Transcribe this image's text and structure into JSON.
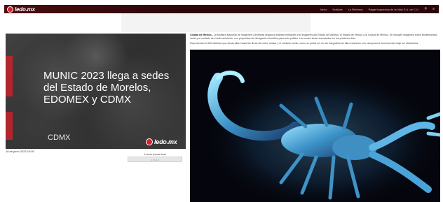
{
  "header": {
    "logo_text": "ledo.mx",
    "nav": [
      "Inicio",
      "Noticias",
      "La Reforma",
      "Pagar Impuestos de la Vida S.A. de C.V."
    ],
    "search_icon": "search-icon",
    "menu_icon": "menu-icon"
  },
  "video": {
    "title": "MUNIC 2023 llega a sedes del Estado de Morelos, EDOMEX y CDMX",
    "city": "CDMX",
    "logo_text": "ledo.mx",
    "date": "18 de junio 2023 16:05",
    "caption": "Lorem ipsum text",
    "button_label": "• • • • •"
  },
  "article": {
    "lead": "Ciudad de México.-",
    "paragraph1": "La Muestra Nacional de Imágenes Científicas llegará a distintas entidades con imágenes del Estado de Morelos, el Estado de México y la Ciudad de México. Se incluyen imágenes sobre biodiversidad, salud y el cuidado del medio ambiente, con propósitos de divulgación científica para todo público. Las sedes serán anunciadas en los próximos días.",
    "paragraph2": "Representan el 500 distintos que desarrollan hasta las fibras del color, celular y el cuidado medio, como se podrá ver en las fotografías de alta resolución con escorpiones fluorescentes bajo luz ultravioleta."
  },
  "colors": {
    "brand_red": "#e21d26",
    "topbar": "#2b0709"
  }
}
